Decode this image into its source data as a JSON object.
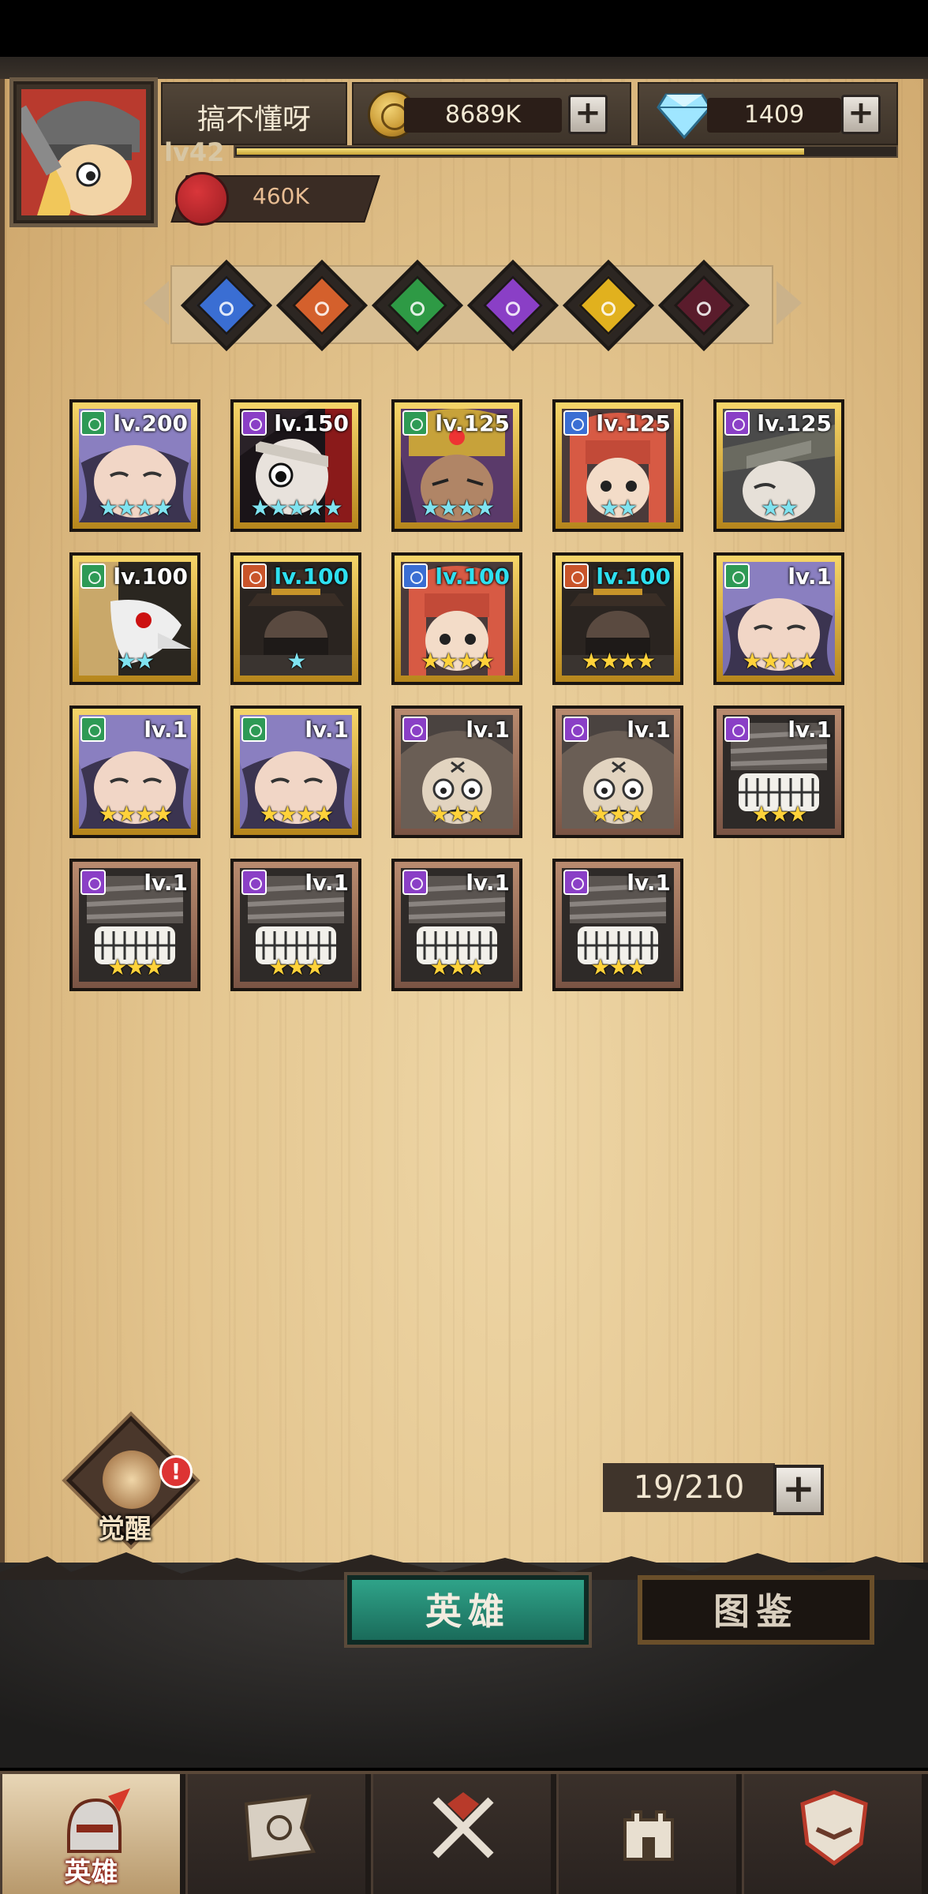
{
  "player": {
    "name": "搞不懂呀",
    "level": "lv42",
    "power": "460K",
    "xp_fraction": 0.86
  },
  "currency": {
    "gold": "8689K",
    "diamonds": "1409",
    "plus_symbol": "+"
  },
  "factions": [
    {
      "name": "blue-faction-icon",
      "color": "#3a6ed3"
    },
    {
      "name": "orange-faction-icon",
      "color": "#d4602c"
    },
    {
      "name": "green-faction-icon",
      "color": "#2e9a45"
    },
    {
      "name": "purple-faction-icon",
      "color": "#8a3fc6"
    },
    {
      "name": "yellow-faction-icon",
      "color": "#e1b11e"
    },
    {
      "name": "crimson-faction-icon",
      "color": "#5a1c2c"
    }
  ],
  "heroes": [
    {
      "level": "lv.200",
      "stars": "★★★★",
      "star_color": "#7fe3f0",
      "frame": "gold",
      "class_color": "#2e9a55",
      "level_color": "#ffffff",
      "portrait": "sleepy-purple-hair"
    },
    {
      "level": "lv.150",
      "stars": "★★★★★",
      "star_color": "#7fe3f0",
      "frame": "gold",
      "class_color": "#8a3fc6",
      "level_color": "#ffffff",
      "portrait": "bandaged-dark"
    },
    {
      "level": "lv.125",
      "stars": "★★★★",
      "star_color": "#7fe3f0",
      "frame": "gold",
      "class_color": "#2e9a55",
      "level_color": "#ffffff",
      "portrait": "turban-mystic"
    },
    {
      "level": "lv.125",
      "stars": "★★",
      "star_color": "#7fe3f0",
      "frame": "gold",
      "class_color": "#3a6ed3",
      "level_color": "#ffffff",
      "portrait": "red-hair-girl"
    },
    {
      "level": "lv.125",
      "stars": "★★",
      "star_color": "#7fe3f0",
      "frame": "gold",
      "class_color": "#8a3fc6",
      "level_color": "#ffffff",
      "portrait": "grey-hat"
    },
    {
      "level": "lv.100",
      "stars": "★★",
      "star_color": "#7fe3f0",
      "frame": "gold",
      "class_color": "#2e9a55",
      "level_color": "#ffffff",
      "portrait": "plague-doctor"
    },
    {
      "level": "lv.100",
      "stars": "★",
      "star_color": "#7fe3f0",
      "frame": "gold",
      "class_color": "#c9542a",
      "level_color": "#2ee0f0",
      "portrait": "hat-gunslinger"
    },
    {
      "level": "lv.100",
      "stars": "★★★★",
      "star_color": "#ffd23a",
      "frame": "gold",
      "class_color": "#3a6ed3",
      "level_color": "#2ee0f0",
      "portrait": "red-hair-girl"
    },
    {
      "level": "lv.100",
      "stars": "★★★★",
      "star_color": "#ffd23a",
      "frame": "gold",
      "class_color": "#c9542a",
      "level_color": "#2ee0f0",
      "portrait": "hat-gunslinger"
    },
    {
      "level": "lv.1",
      "stars": "★★★★",
      "star_color": "#ffd23a",
      "frame": "gold",
      "class_color": "#2e9a55",
      "level_color": "#ffffff",
      "portrait": "sleepy-purple-hair"
    },
    {
      "level": "lv.1",
      "stars": "★★★★",
      "star_color": "#ffd23a",
      "frame": "gold",
      "class_color": "#2e9a55",
      "level_color": "#ffffff",
      "portrait": "sleepy-purple-hair"
    },
    {
      "level": "lv.1",
      "stars": "★★★★",
      "star_color": "#ffd23a",
      "frame": "gold",
      "class_color": "#2e9a55",
      "level_color": "#ffffff",
      "portrait": "sleepy-purple-hair"
    },
    {
      "level": "lv.1",
      "stars": "★★★",
      "star_color": "#ffd23a",
      "frame": "bronze",
      "class_color": "#8a3fc6",
      "level_color": "#ffffff",
      "portrait": "hooded-sad"
    },
    {
      "level": "lv.1",
      "stars": "★★★",
      "star_color": "#ffd23a",
      "frame": "bronze",
      "class_color": "#8a3fc6",
      "level_color": "#ffffff",
      "portrait": "hooded-sad"
    },
    {
      "level": "lv.1",
      "stars": "★★★",
      "star_color": "#ffd23a",
      "frame": "bronze",
      "class_color": "#8a3fc6",
      "level_color": "#ffffff",
      "portrait": "mummy-grin"
    },
    {
      "level": "lv.1",
      "stars": "★★★",
      "star_color": "#ffd23a",
      "frame": "bronze",
      "class_color": "#8a3fc6",
      "level_color": "#ffffff",
      "portrait": "mummy-grin"
    },
    {
      "level": "lv.1",
      "stars": "★★★",
      "star_color": "#ffd23a",
      "frame": "bronze",
      "class_color": "#8a3fc6",
      "level_color": "#ffffff",
      "portrait": "mummy-grin"
    },
    {
      "level": "lv.1",
      "stars": "★★★",
      "star_color": "#ffd23a",
      "frame": "bronze",
      "class_color": "#8a3fc6",
      "level_color": "#ffffff",
      "portrait": "mummy-grin"
    },
    {
      "level": "lv.1",
      "stars": "★★★",
      "star_color": "#ffd23a",
      "frame": "bronze",
      "class_color": "#8a3fc6",
      "level_color": "#ffffff",
      "portrait": "mummy-grin"
    }
  ],
  "awaken": {
    "label": "觉醒",
    "badge": "!"
  },
  "capacity": {
    "value": "19/210",
    "plus": "+"
  },
  "tabs": {
    "heroes": "英雄",
    "codex": "图鉴"
  },
  "nav": [
    {
      "label": "英雄",
      "icon": "helmet-icon",
      "active": true
    },
    {
      "label": "",
      "icon": "battle-flag-icon",
      "active": false
    },
    {
      "label": "",
      "icon": "crossed-swords-icon",
      "active": false
    },
    {
      "label": "",
      "icon": "castle-icon",
      "active": false
    },
    {
      "label": "",
      "icon": "handshake-shield-icon",
      "active": false
    }
  ]
}
